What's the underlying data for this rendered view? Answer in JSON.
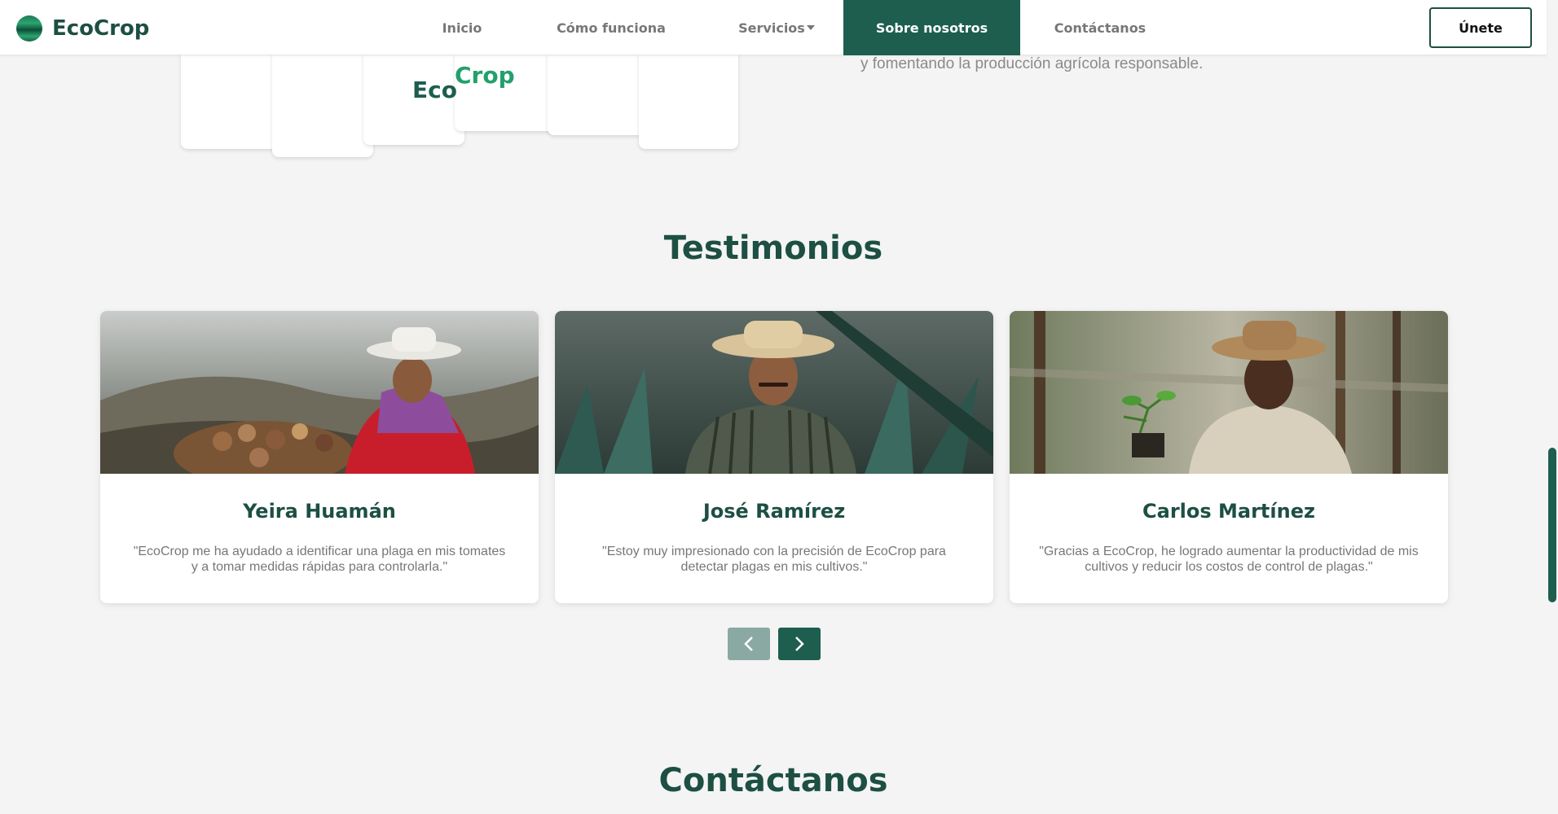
{
  "brand": {
    "name": "EcoCrop"
  },
  "nav": {
    "items": [
      {
        "label": "Inicio"
      },
      {
        "label": "Cómo funciona"
      },
      {
        "label": "Servicios"
      },
      {
        "label": "Sobre nosotros"
      },
      {
        "label": "Contáctanos"
      }
    ],
    "join_label": "Únete"
  },
  "about": {
    "logo_eco": "Eco",
    "logo_crop": "Crop",
    "text_tail": "y fomentando la producción agrícola responsable."
  },
  "testimonials": {
    "title": "Testimonios",
    "cards": [
      {
        "name": "Yeira Huamán",
        "quote": "\"EcoCrop me ha ayudado a identificar una plaga en mis tomates y a tomar medidas rápidas para controlarla.\""
      },
      {
        "name": "José Ramírez",
        "quote": "\"Estoy muy impresionado con la precisión de EcoCrop para detectar plagas en mis cultivos.\""
      },
      {
        "name": "Carlos Martínez",
        "quote": "\"Gracias a EcoCrop, he logrado aumentar la productividad de mis cultivos y reducir los costos de control de plagas.\""
      }
    ]
  },
  "contact": {
    "title": "Contáctanos"
  },
  "colors": {
    "primary": "#1d5e4e",
    "heading": "#1d4f43",
    "accent": "#22a06b",
    "muted_button": "#8aa9a2"
  },
  "icons": {
    "prev": "chevron-left-icon",
    "next": "chevron-right-icon"
  }
}
